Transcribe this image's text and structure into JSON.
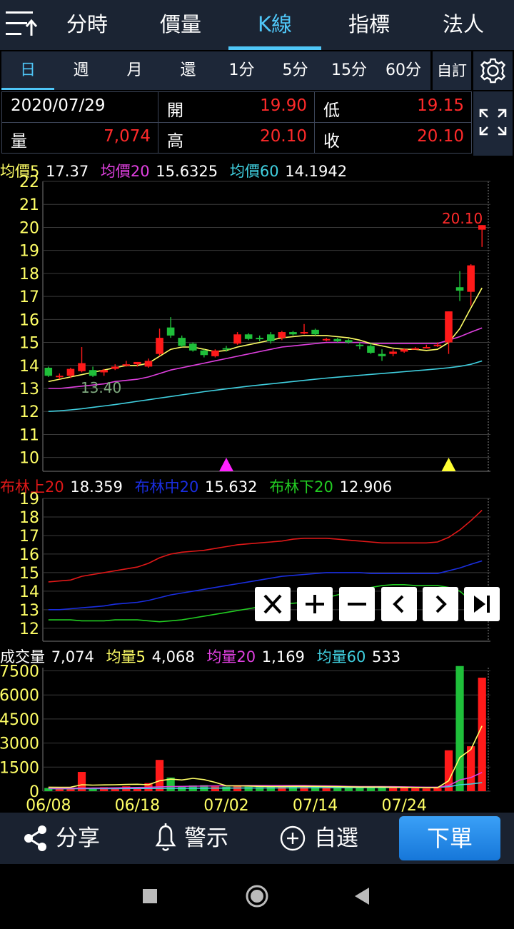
{
  "top_tabs": [
    "分時",
    "價量",
    "K線",
    "指標",
    "法人"
  ],
  "active_top_tab": 2,
  "period_tabs": [
    "日",
    "週",
    "月",
    "還",
    "1分",
    "5分",
    "15分",
    "60分"
  ],
  "active_period_tab": 0,
  "custom_label": "自訂",
  "info": {
    "date": "2020/07/29",
    "open_label": "開",
    "open": "19.90",
    "low_label": "低",
    "low": "19.15",
    "volume_label": "量",
    "volume": "7,074",
    "high_label": "高",
    "high": "20.10",
    "close_label": "收",
    "close": "20.10"
  },
  "ma_legend": {
    "ma5_label": "均價5",
    "ma5": "17.37",
    "ma20_label": "均價20",
    "ma20": "15.6325",
    "ma60_label": "均價60",
    "ma60": "14.1942"
  },
  "boll_legend": {
    "upper_label": "布林上20",
    "upper": "18.359",
    "mid_label": "布林中20",
    "mid": "15.632",
    "lower_label": "布林下20",
    "lower": "12.906"
  },
  "vol_legend": {
    "vol_label": "成交量",
    "vol": "7,074",
    "v5_label": "均量5",
    "v5": "4,068",
    "v20_label": "均量20",
    "v20": "1,169",
    "v60_label": "均量60",
    "v60": "533"
  },
  "colors": {
    "up": "#ff1a1a",
    "down": "#1fbf3a",
    "ma5": "#ffff66",
    "ma20": "#e040e0",
    "ma60": "#40d0e0",
    "boll_upper": "#e01818",
    "boll_mid": "#1a2ee0",
    "boll_lower": "#22cc22",
    "axis_text": "#ffff66",
    "grid": "#3a3a3a"
  },
  "chart_data": [
    {
      "type": "candlestick",
      "y_ticks": [
        10,
        11,
        12,
        13,
        14,
        15,
        16,
        17,
        18,
        19,
        20,
        21,
        22
      ],
      "ylim": [
        9.4,
        22
      ],
      "candles": [
        {
          "o": 13.9,
          "h": 13.95,
          "l": 13.5,
          "c": 13.55
        },
        {
          "o": 13.5,
          "h": 13.65,
          "l": 13.4,
          "c": 13.55
        },
        {
          "o": 13.55,
          "h": 13.9,
          "l": 13.45,
          "c": 13.85
        },
        {
          "o": 13.75,
          "h": 14.8,
          "l": 13.7,
          "c": 14.1
        },
        {
          "o": 13.8,
          "h": 13.95,
          "l": 13.5,
          "c": 13.55
        },
        {
          "o": 13.7,
          "h": 13.85,
          "l": 13.55,
          "c": 13.8
        },
        {
          "o": 13.85,
          "h": 14.05,
          "l": 13.8,
          "c": 13.95
        },
        {
          "o": 14.05,
          "h": 14.2,
          "l": 13.95,
          "c": 14.05
        },
        {
          "o": 14.05,
          "h": 14.15,
          "l": 13.95,
          "c": 14.15
        },
        {
          "o": 13.95,
          "h": 14.3,
          "l": 13.9,
          "c": 14.2
        },
        {
          "o": 14.5,
          "h": 15.6,
          "l": 14.4,
          "c": 15.2
        },
        {
          "o": 15.65,
          "h": 16.1,
          "l": 15.2,
          "c": 15.3
        },
        {
          "o": 15.2,
          "h": 15.3,
          "l": 14.8,
          "c": 14.85
        },
        {
          "o": 14.95,
          "h": 15.0,
          "l": 14.6,
          "c": 14.65
        },
        {
          "o": 14.65,
          "h": 14.7,
          "l": 14.35,
          "c": 14.45
        },
        {
          "o": 14.4,
          "h": 14.7,
          "l": 14.35,
          "c": 14.65
        },
        {
          "o": 14.75,
          "h": 14.85,
          "l": 14.6,
          "c": 14.7
        },
        {
          "o": 14.95,
          "h": 15.45,
          "l": 14.9,
          "c": 15.35
        },
        {
          "o": 15.35,
          "h": 15.4,
          "l": 15.1,
          "c": 15.15
        },
        {
          "o": 15.2,
          "h": 15.3,
          "l": 15.05,
          "c": 15.15
        },
        {
          "o": 15.35,
          "h": 15.45,
          "l": 14.95,
          "c": 15.05
        },
        {
          "o": 15.2,
          "h": 15.5,
          "l": 15.1,
          "c": 15.45
        },
        {
          "o": 15.45,
          "h": 15.5,
          "l": 15.3,
          "c": 15.35
        },
        {
          "o": 15.45,
          "h": 15.8,
          "l": 15.35,
          "c": 15.45
        },
        {
          "o": 15.55,
          "h": 15.6,
          "l": 15.3,
          "c": 15.35
        },
        {
          "o": 15.15,
          "h": 15.2,
          "l": 15.05,
          "c": 15.15
        },
        {
          "o": 15.15,
          "h": 15.2,
          "l": 15.0,
          "c": 15.05
        },
        {
          "o": 15.1,
          "h": 15.15,
          "l": 14.95,
          "c": 15.0
        },
        {
          "o": 14.9,
          "h": 15.0,
          "l": 14.7,
          "c": 14.85
        },
        {
          "o": 14.85,
          "h": 14.95,
          "l": 14.5,
          "c": 14.55
        },
        {
          "o": 14.5,
          "h": 14.7,
          "l": 14.2,
          "c": 14.4
        },
        {
          "o": 14.5,
          "h": 14.7,
          "l": 14.4,
          "c": 14.6
        },
        {
          "o": 14.6,
          "h": 14.75,
          "l": 14.55,
          "c": 14.7
        },
        {
          "o": 14.75,
          "h": 14.8,
          "l": 14.7,
          "c": 14.75
        },
        {
          "o": 14.8,
          "h": 14.9,
          "l": 14.75,
          "c": 14.8
        },
        {
          "o": 14.9,
          "h": 15.0,
          "l": 14.8,
          "c": 14.9
        },
        {
          "o": 15.0,
          "h": 16.35,
          "l": 14.5,
          "c": 16.35
        },
        {
          "o": 17.4,
          "h": 18.1,
          "l": 16.8,
          "c": 17.25
        },
        {
          "o": 17.2,
          "h": 18.4,
          "l": 16.6,
          "c": 18.35
        },
        {
          "o": 19.9,
          "h": 20.1,
          "l": 19.15,
          "c": 20.1
        }
      ],
      "ma5": [
        13.3,
        13.4,
        13.5,
        13.6,
        13.7,
        13.8,
        13.9,
        14.0,
        14.0,
        14.1,
        14.4,
        14.7,
        14.8,
        14.8,
        14.7,
        14.6,
        14.65,
        14.8,
        14.9,
        15.0,
        15.1,
        15.2,
        15.25,
        15.3,
        15.3,
        15.3,
        15.25,
        15.2,
        15.1,
        14.95,
        14.85,
        14.75,
        14.7,
        14.7,
        14.65,
        14.7,
        15.0,
        15.6,
        16.5,
        17.37
      ],
      "ma20": [
        13.0,
        13.0,
        13.05,
        13.1,
        13.15,
        13.2,
        13.3,
        13.35,
        13.4,
        13.5,
        13.65,
        13.8,
        13.9,
        14.0,
        14.1,
        14.2,
        14.3,
        14.4,
        14.5,
        14.6,
        14.7,
        14.8,
        14.85,
        14.9,
        14.95,
        15.0,
        15.0,
        15.0,
        15.0,
        14.95,
        14.95,
        14.95,
        14.95,
        14.95,
        14.95,
        14.95,
        15.1,
        15.25,
        15.45,
        15.6325
      ],
      "ma60": [
        12.0,
        12.03,
        12.07,
        12.12,
        12.18,
        12.24,
        12.3,
        12.37,
        12.44,
        12.51,
        12.58,
        12.65,
        12.72,
        12.79,
        12.86,
        12.92,
        12.98,
        13.04,
        13.1,
        13.15,
        13.2,
        13.25,
        13.3,
        13.35,
        13.4,
        13.45,
        13.49,
        13.53,
        13.57,
        13.61,
        13.65,
        13.69,
        13.73,
        13.77,
        13.81,
        13.85,
        13.9,
        13.96,
        14.05,
        14.1942
      ],
      "annotations": [
        {
          "label": "13.40"
        },
        {
          "label": "20.10"
        }
      ]
    },
    {
      "type": "line",
      "y_ticks": [
        12,
        13,
        14,
        15,
        16,
        17,
        18,
        19
      ],
      "ylim": [
        11.3,
        19
      ],
      "upper": [
        14.5,
        14.55,
        14.6,
        14.8,
        14.9,
        15.0,
        15.1,
        15.2,
        15.3,
        15.5,
        15.8,
        16.0,
        16.1,
        16.15,
        16.2,
        16.3,
        16.4,
        16.5,
        16.55,
        16.6,
        16.65,
        16.7,
        16.8,
        16.85,
        16.85,
        16.85,
        16.8,
        16.75,
        16.7,
        16.65,
        16.6,
        16.6,
        16.6,
        16.6,
        16.6,
        16.65,
        16.9,
        17.3,
        17.8,
        18.359
      ],
      "mid": [
        13.0,
        13.0,
        13.05,
        13.1,
        13.15,
        13.2,
        13.3,
        13.35,
        13.4,
        13.5,
        13.65,
        13.8,
        13.9,
        14.0,
        14.1,
        14.2,
        14.3,
        14.4,
        14.5,
        14.6,
        14.7,
        14.8,
        14.85,
        14.9,
        14.95,
        15.0,
        15.0,
        15.0,
        15.0,
        14.95,
        14.95,
        14.95,
        14.95,
        14.95,
        14.95,
        14.95,
        15.1,
        15.25,
        15.45,
        15.632
      ],
      "lower": [
        12.45,
        12.45,
        12.45,
        12.4,
        12.4,
        12.4,
        12.45,
        12.45,
        12.45,
        12.4,
        12.35,
        12.4,
        12.45,
        12.55,
        12.65,
        12.75,
        12.85,
        12.95,
        13.05,
        13.15,
        13.25,
        13.3,
        13.35,
        13.4,
        13.55,
        13.65,
        13.8,
        13.95,
        14.1,
        14.2,
        14.3,
        14.35,
        14.35,
        14.3,
        14.3,
        14.3,
        14.2,
        14.0,
        13.5,
        12.906
      ]
    },
    {
      "type": "bar",
      "y_ticks": [
        0,
        1500,
        3000,
        4500,
        6000,
        7500
      ],
      "ylim": [
        0,
        7700
      ],
      "x_labels": [
        {
          "i": 0,
          "label": "06/08"
        },
        {
          "i": 8,
          "label": "06/18"
        },
        {
          "i": 16,
          "label": "07/02"
        },
        {
          "i": 24,
          "label": "07/14"
        },
        {
          "i": 32,
          "label": "07/24"
        }
      ],
      "volume": [
        200,
        150,
        220,
        1200,
        150,
        250,
        230,
        300,
        200,
        500,
        1950,
        850,
        320,
        360,
        380,
        300,
        280,
        300,
        280,
        260,
        280,
        300,
        290,
        310,
        300,
        280,
        260,
        240,
        230,
        280,
        300,
        220,
        200,
        180,
        170,
        200,
        2550,
        7800,
        2800,
        7074
      ],
      "v5": [
        250,
        240,
        250,
        400,
        380,
        390,
        400,
        420,
        430,
        400,
        650,
        750,
        700,
        800,
        720,
        550,
        340,
        330,
        320,
        300,
        290,
        290,
        300,
        300,
        300,
        290,
        280,
        270,
        260,
        260,
        260,
        250,
        240,
        230,
        220,
        220,
        650,
        2100,
        2600,
        4068
      ],
      "v20": [
        180,
        180,
        185,
        190,
        195,
        200,
        210,
        220,
        230,
        240,
        270,
        290,
        300,
        310,
        320,
        330,
        340,
        340,
        350,
        350,
        350,
        350,
        350,
        350,
        340,
        330,
        320,
        300,
        290,
        290,
        290,
        280,
        270,
        260,
        250,
        250,
        350,
        700,
        850,
        1169
      ],
      "v60": [
        150,
        150,
        152,
        155,
        158,
        160,
        162,
        165,
        168,
        170,
        175,
        180,
        182,
        185,
        188,
        190,
        192,
        195,
        198,
        200,
        202,
        205,
        208,
        210,
        212,
        215,
        218,
        220,
        222,
        225,
        228,
        230,
        232,
        235,
        238,
        240,
        280,
        400,
        450,
        533
      ]
    }
  ],
  "bottom_bar": {
    "share": "分享",
    "alert": "警示",
    "watchlist": "自選",
    "order": "下單"
  }
}
